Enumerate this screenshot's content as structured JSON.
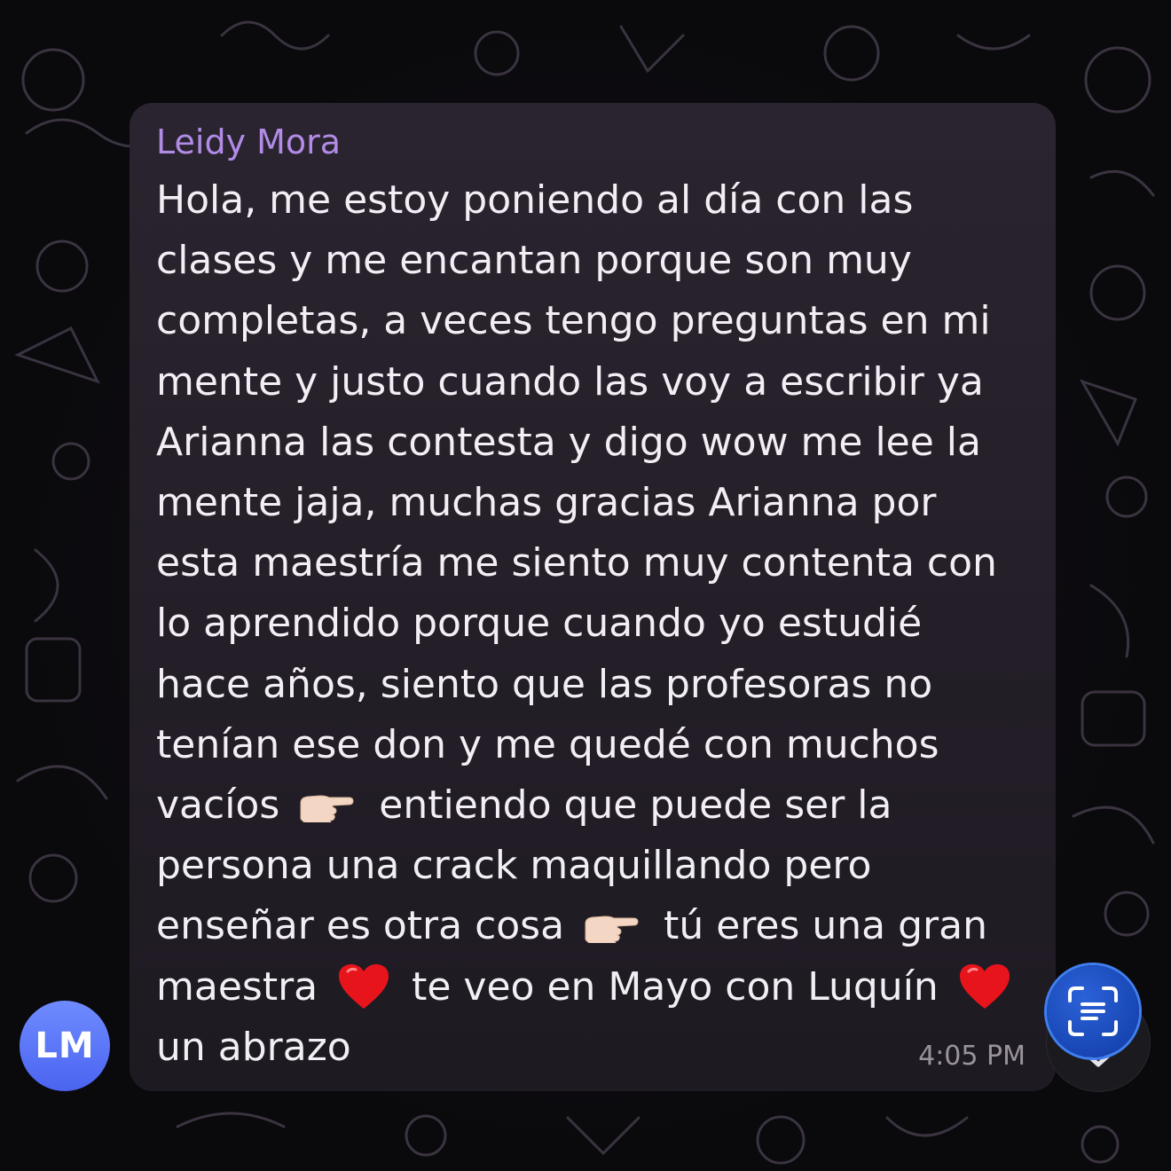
{
  "message": {
    "sender": "Leidy Mora",
    "lines": [
      "Hola, me estoy poniendo al día con las",
      "clases y me encantan porque son muy",
      "completas, a veces tengo preguntas en mi",
      "mente y justo cuando las voy a escribir ya",
      "Arianna las contesta y digo wow me lee la",
      "mente jaja, muchas gracias Arianna por",
      "esta maestría me siento muy contenta con",
      "lo aprendido porque cuando yo estudié",
      "hace años, siento que las profesoras no",
      "tenían ese don y me quedé con muchos"
    ],
    "line11_a": "vacíos",
    "line11_b": "entiendo que puede ser la",
    "line12": "persona una crack maquillando pero",
    "line13_a": "enseñar es otra cosa",
    "line13_b": "tú eres una gran",
    "line14_a": "maestra",
    "line14_b": "te veo en Mayo con Luquín",
    "line15": "un abrazo",
    "time": "4:05 PM"
  },
  "avatar": {
    "initials": "LM",
    "color": "#5a74f7"
  },
  "icons": {
    "pointing_emoji": "backhand-index-pointing-right-icon",
    "heart_emoji": "red-heart-icon",
    "scan_button": "scan-text-icon",
    "scroll_down": "chevron-down-icon"
  },
  "colors": {
    "sender": "#b28be6",
    "bubble": "#27212c",
    "background": "#0b0a0d",
    "scan_button": "#1f50c4"
  }
}
